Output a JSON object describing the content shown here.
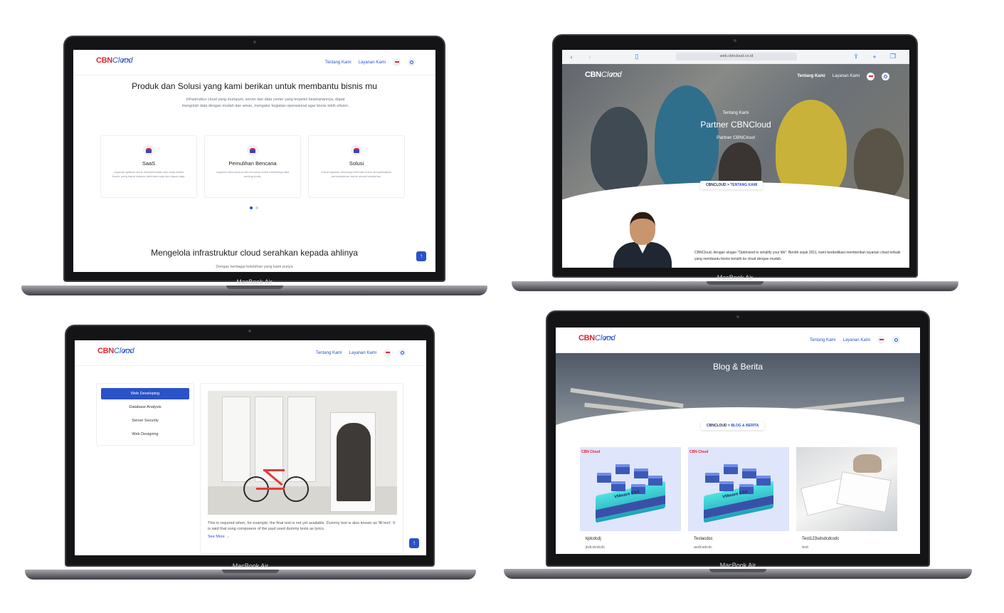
{
  "laptop_model": "MacBook Air",
  "colors": {
    "brand_red": "#e3262f",
    "brand_blue": "#2a52c9"
  },
  "site": {
    "logo_primary": "CBN",
    "logo_secondary": "Cloud",
    "nav": {
      "about": "Tentang Kami",
      "services": "Layanan Kami"
    },
    "fab_icon": "↑"
  },
  "screen1": {
    "headline": "Produk dan Solusi yang kami berikan untuk membantu bisnis mu",
    "intro": "Infrastruktur cloud yang mumpuni, server dan data center yang terjamin keamanannya, dapat mengolah data dengan mudah dan aman, mengatur kegiatan operasional agar bisnis lebih efisien.",
    "cards": [
      {
        "title": "SaaS",
        "desc": "Layanan aplikasi untuk mempermudah alur kerja dalam bisnis, yang dapat diakses darimana saja dan kapan saja."
      },
      {
        "title": "Pemulihan Bencana",
        "desc": "Layanan data backup dan recovery untuk melindungi data penting Anda."
      },
      {
        "title": "Solusi",
        "desc": "Solusi layanan teknologi informasi untuk menyelesaikan permasalahan bisnis sesuai kebutuhan."
      }
    ],
    "headline2": "Mengelola infrastruktur cloud serahkan kepada ahlinya",
    "sub2": "Dengan berbagai kelebihan yang kami punya"
  },
  "screen2": {
    "url": "web.cbncloud.co.id",
    "overline": "Tentang Kami",
    "title": "Partner CBNCloud",
    "subtitle": "Partner CBNCloud",
    "breadcrumb": {
      "root": "CBNCLOUD",
      "sep": ">",
      "current": "TENTANG KAMI"
    },
    "body": "CBNCloud, dengan slogan \"Optimized to simplify your life\". Berdiri sejak 2011, kami berdedikasi memberikan layanan cloud terbaik yang membantu bisnis beralih ke cloud dengan mudah."
  },
  "screen3": {
    "menu": [
      "Web Developing",
      "Database Analysis",
      "Server Security",
      "Web Designing"
    ],
    "active_index": 0,
    "post_text": "This is required when, for example, the final text is not yet available. Dummy text is also known as 'fill text'. It is said that song composers of the past used dummy texts as lyrics.",
    "see_more": "See More",
    "see_more_icon": "→"
  },
  "screen4": {
    "title": "Blog & Berita",
    "breadcrumb": {
      "root": "CBNCLOUD",
      "sep": ">",
      "current": "BLOG & BERITA"
    },
    "posts": [
      {
        "title": "kjdcdcdj",
        "subtitle": "jkdcdcdcdc",
        "image": "vmware-esx-illustration",
        "tag": "CBN Cloud",
        "label": "VMware ESX"
      },
      {
        "title": "Testacdsc",
        "subtitle": "asdcsdcdc",
        "image": "vmware-esx-illustration",
        "tag": "CBN Cloud",
        "label": "VMware ESX"
      },
      {
        "title": "Test123sdsdcdcsdc",
        "subtitle": "test",
        "image": "office-documents-photo"
      }
    ]
  }
}
